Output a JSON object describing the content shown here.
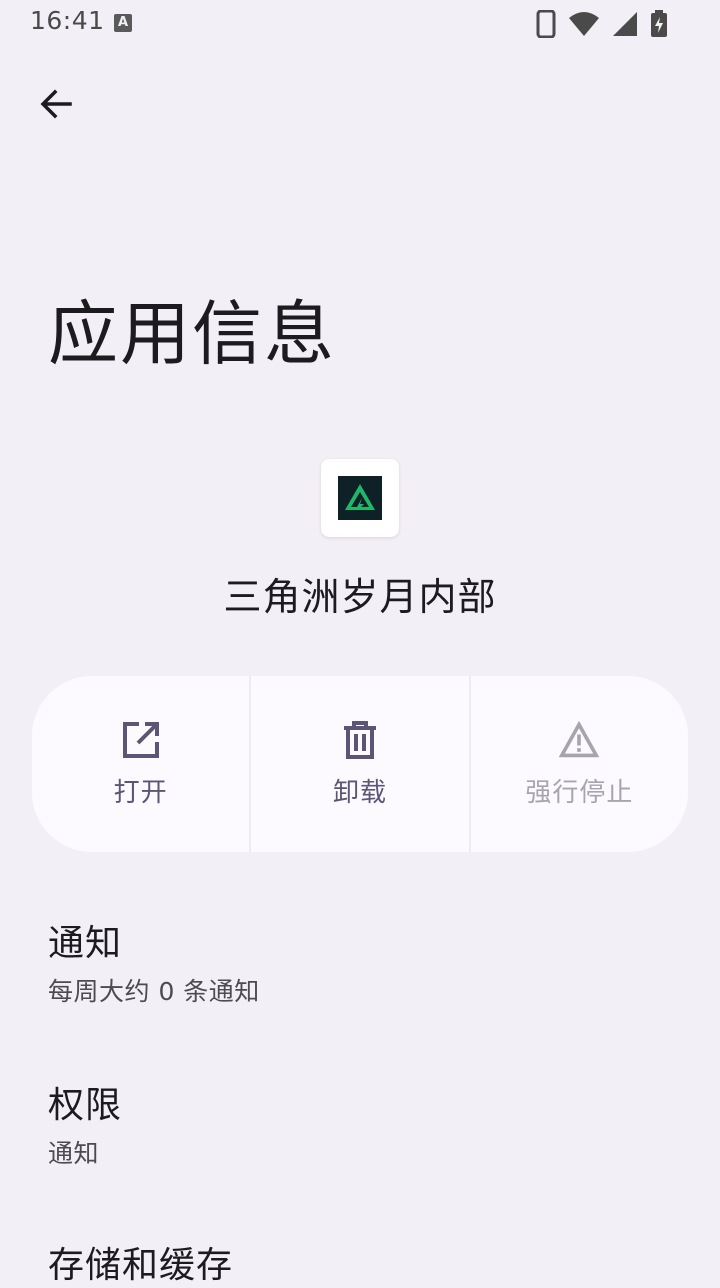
{
  "status_bar": {
    "time": "16:41",
    "notification_icon": "A"
  },
  "header": {
    "title": "应用信息"
  },
  "app": {
    "name": "三角洲岁月内部"
  },
  "actions": [
    {
      "label": "打开",
      "icon": "open-external-icon",
      "enabled": true
    },
    {
      "label": "卸载",
      "icon": "trash-icon",
      "enabled": true
    },
    {
      "label": "强行停止",
      "icon": "warning-icon",
      "enabled": false
    }
  ],
  "settings": [
    {
      "title": "通知",
      "summary": "每周大约 0 条通知"
    },
    {
      "title": "权限",
      "summary": "通知"
    },
    {
      "title": "存储和缓存",
      "summary": ""
    }
  ],
  "colors": {
    "background": "#f3eff6",
    "card": "#fdfaff",
    "accent": "#5b5676",
    "disabled": "#a7a4ad",
    "app_icon_green": "#1fb86a"
  }
}
